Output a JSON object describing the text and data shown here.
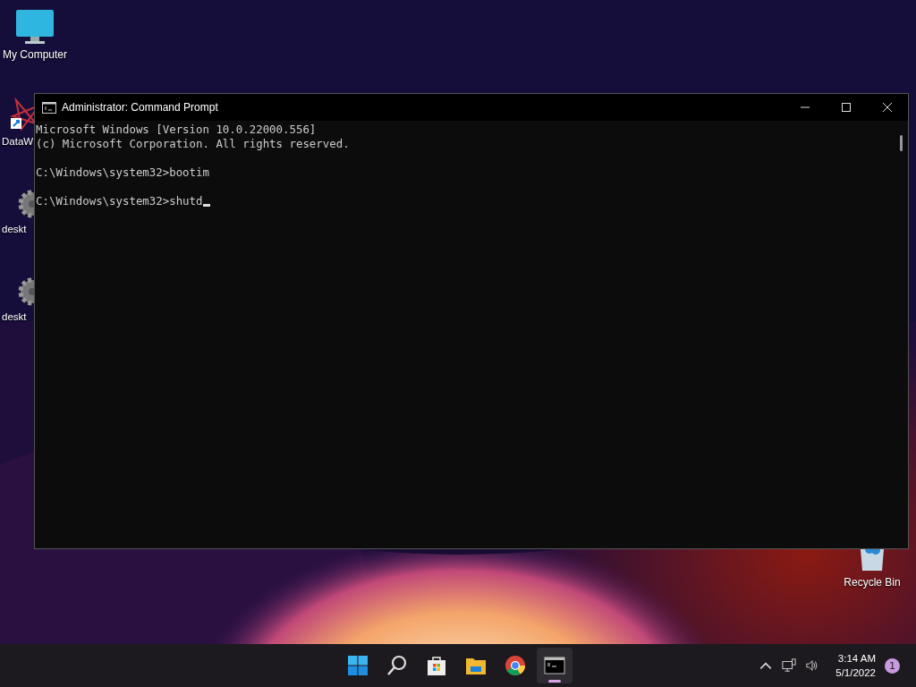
{
  "desktop_icons": [
    {
      "kind": "computer",
      "label": "My Computer"
    },
    {
      "kind": "shortcut",
      "label": "DataW"
    },
    {
      "kind": "gear",
      "label": "deskt"
    },
    {
      "kind": "gear",
      "label": "deskt"
    },
    {
      "kind": "recycle",
      "label": "Recycle Bin"
    }
  ],
  "window": {
    "title": "Administrator: Command Prompt",
    "cursor_visible": true,
    "console_blocks": [
      [
        "Microsoft Windows [Version 10.0.22000.556]",
        "(c) Microsoft Corporation. All rights reserved."
      ],
      [
        "C:\\Windows\\system32>bootim"
      ],
      [
        "C:\\Windows\\system32>shutd"
      ]
    ]
  },
  "taskbar": {
    "apps": [
      {
        "kind": "start",
        "selected": false
      },
      {
        "kind": "search",
        "selected": false
      },
      {
        "kind": "store",
        "selected": false
      },
      {
        "kind": "explorer",
        "selected": false
      },
      {
        "kind": "browser",
        "selected": false
      },
      {
        "kind": "terminal",
        "selected": true
      }
    ],
    "time": "3:14 AM",
    "date": "5/1/2022",
    "notification_count": "1"
  }
}
